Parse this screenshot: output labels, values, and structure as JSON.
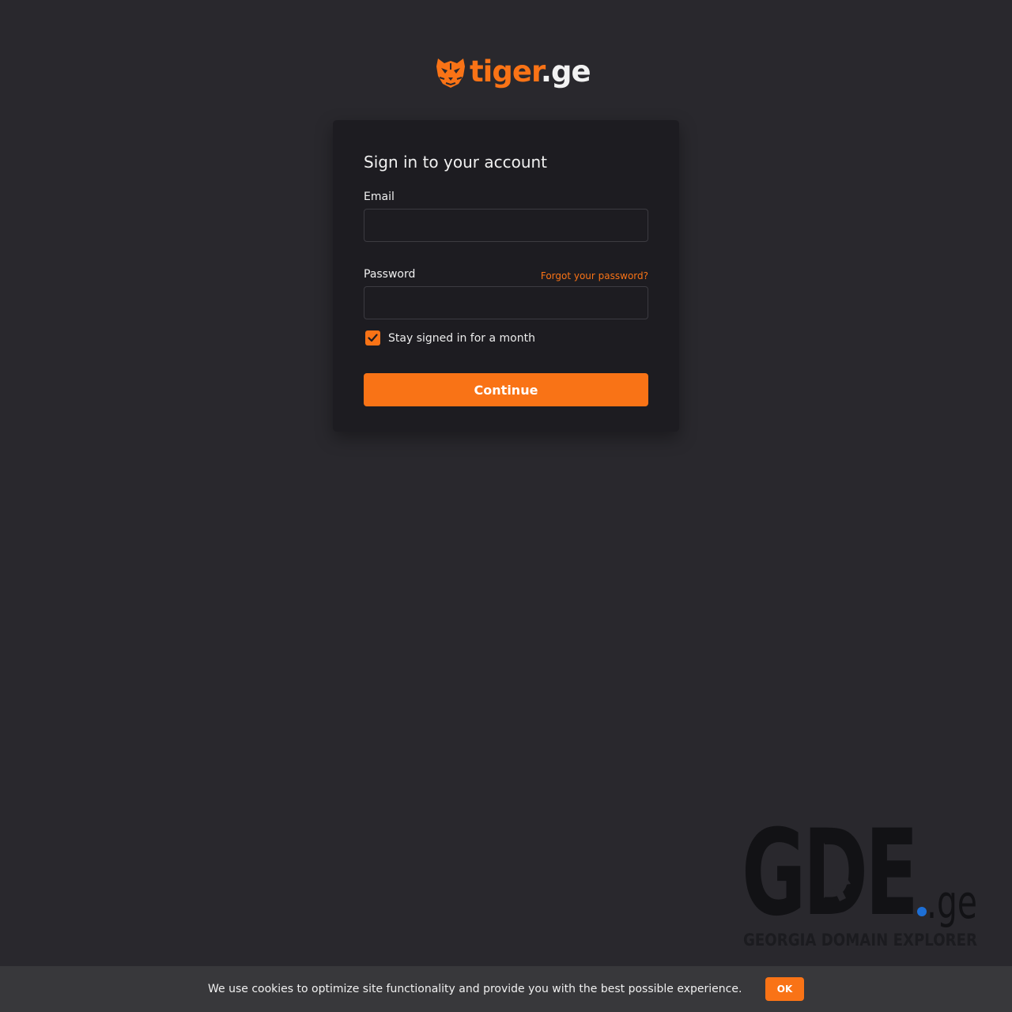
{
  "brand": {
    "name_part1": "tiger",
    "name_part2": ".ge",
    "accent_color": "#f97316",
    "icon": "tiger-head-icon"
  },
  "login": {
    "title": "Sign in to your account",
    "email_label": "Email",
    "email_value": "",
    "password_label": "Password",
    "password_value": "",
    "forgot_link": "Forgot your password?",
    "remember_label": "Stay signed in for a month",
    "remember_checked": true,
    "submit_label": "Continue"
  },
  "watermark": {
    "logo_main": "GDE",
    "logo_suffix": ".ge",
    "tagline": "GEORGIA DOMAIN EXPLORER"
  },
  "cookie_banner": {
    "text": "We use cookies to optimize site functionality and provide you with the best possible experience.",
    "ok_label": "OK"
  }
}
